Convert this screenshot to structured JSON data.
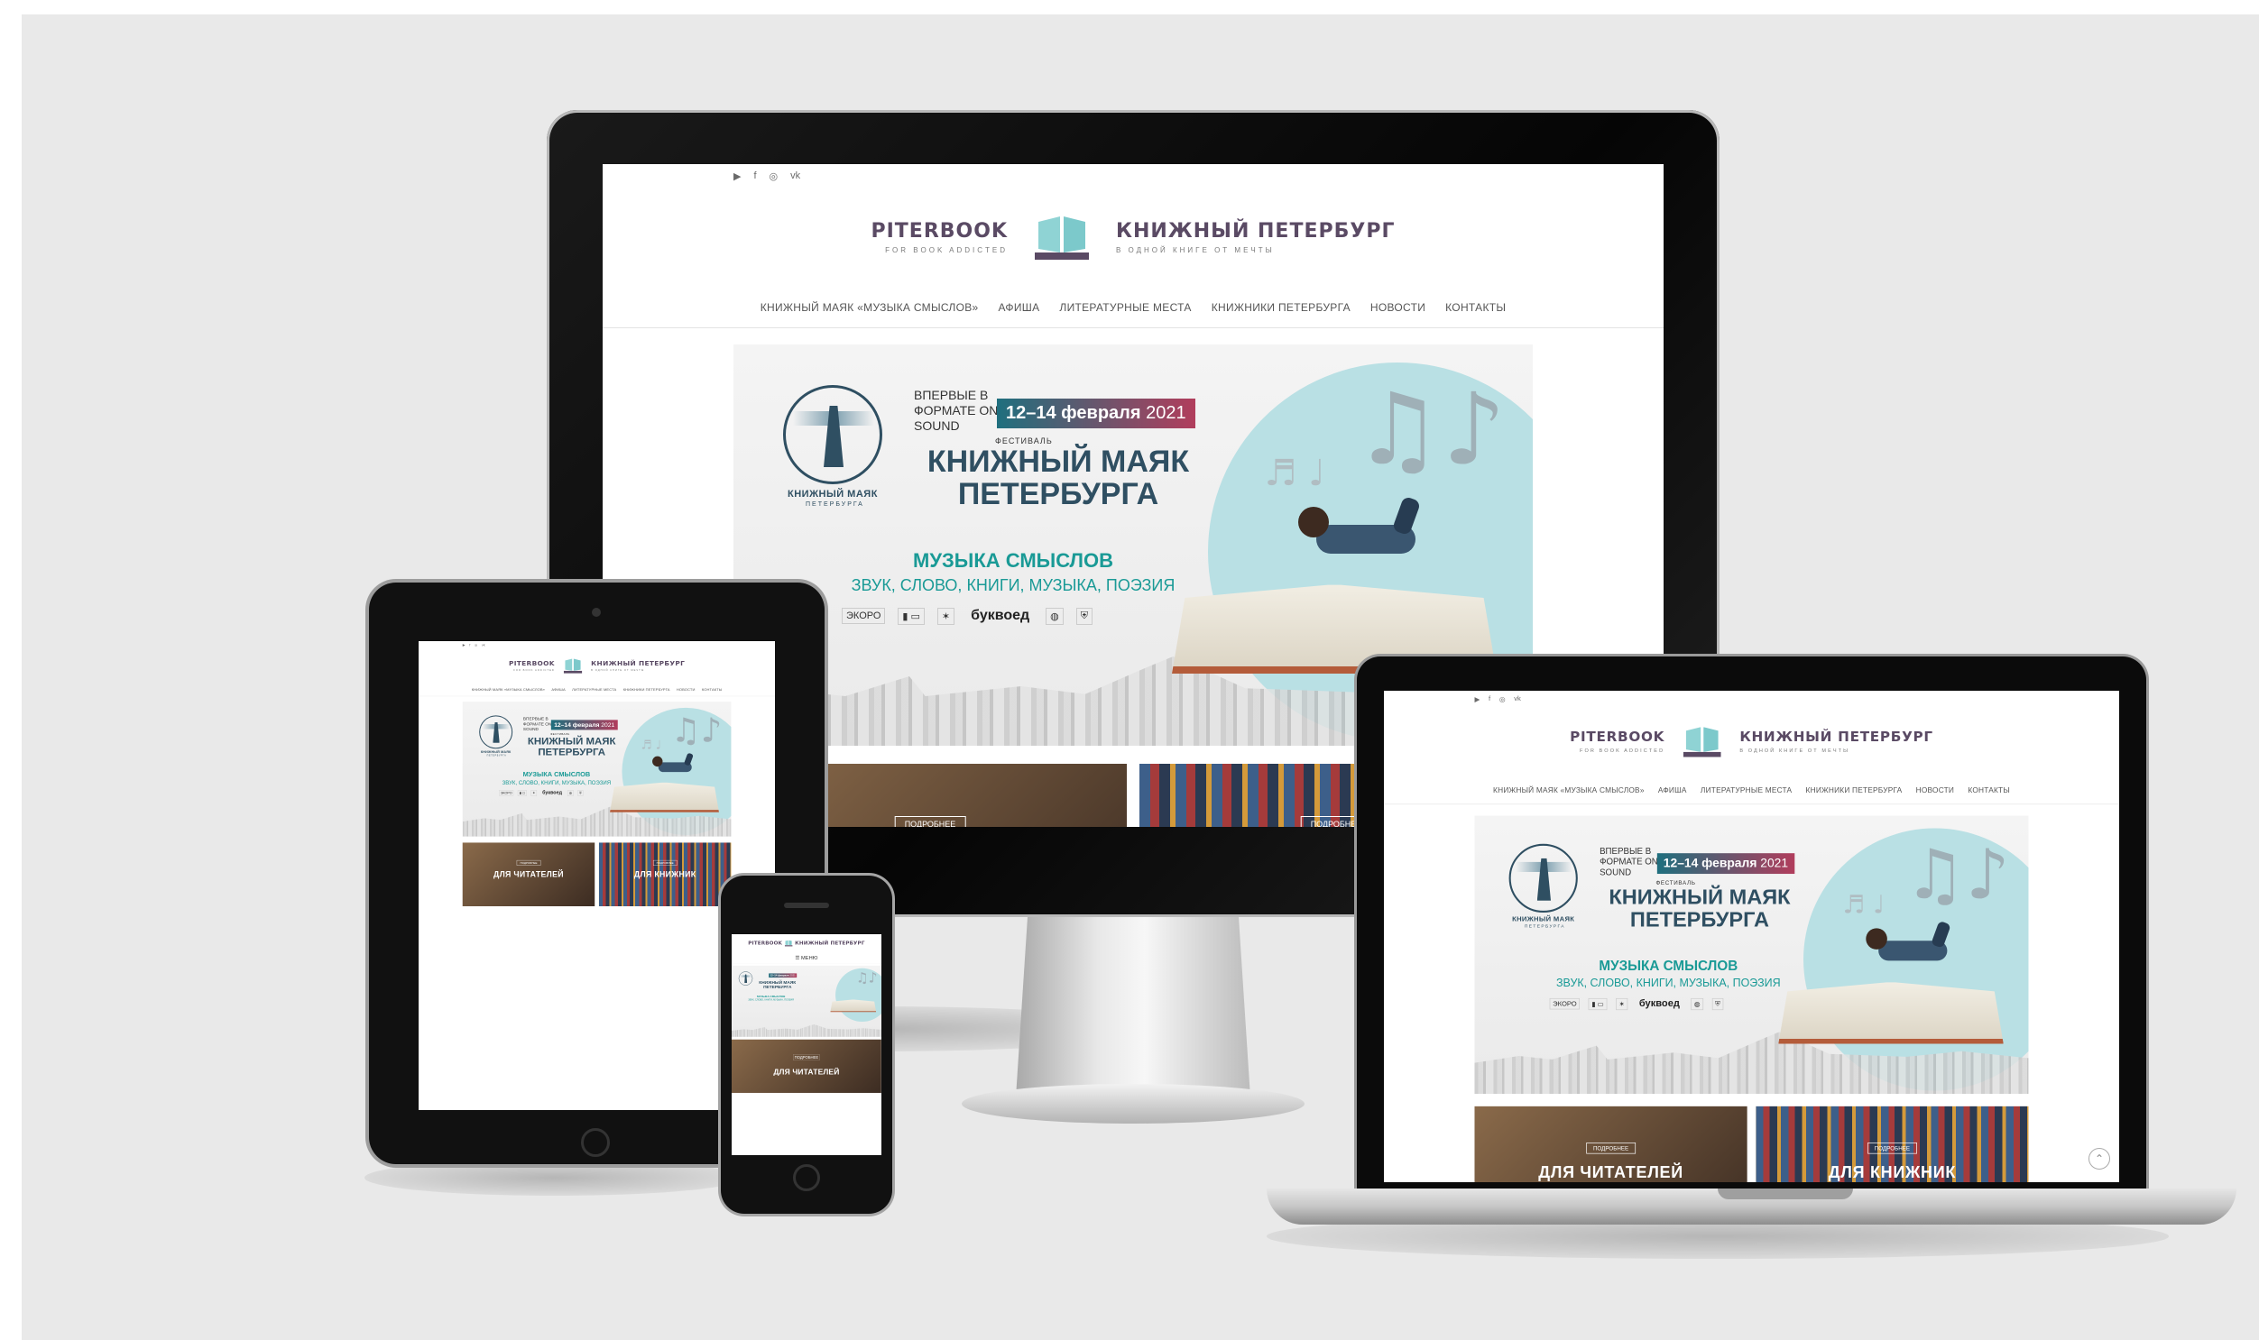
{
  "site": {
    "social_icons": [
      "youtube-icon",
      "facebook-icon",
      "instagram-icon",
      "vk-icon"
    ],
    "brand_left": {
      "main": "PITERBOOK",
      "sub": "FOR BOOK ADDICTED"
    },
    "brand_right": {
      "main": "КНИЖНЫЙ ПЕТЕРБУРГ",
      "sub": "В ОДНОЙ КНИГЕ ОТ МЕЧТЫ"
    },
    "nav": [
      "Книжный маяк «Музыка смыслов»",
      "Афиша",
      "Литературные места",
      "Книжники Петербурга",
      "Новости",
      "Контакты"
    ],
    "banner": {
      "first_time": "ВПЕРВЫЕ В ФОРМАТЕ ON-SOUND",
      "date_main": "12–14 февраля",
      "date_year": " 2021",
      "festival": "ФЕСТИВАЛЬ",
      "title": "КНИЖНЫЙ МАЯК ПЕТЕРБУРГА",
      "emblem_caption": "КНИЖНЫЙ МАЯК",
      "emblem_sub": "ПЕТЕРБУРГА",
      "music": "МУЗЫКА СМЫСЛОВ",
      "genres": "ЗВУК, СЛОВО, КНИГИ, МУЗЫКА, ПОЭЗИЯ",
      "partners": [
        "ЭКОРО",
        "буквоед"
      ]
    },
    "tiles": [
      {
        "button": "ПОДРОБНЕЕ",
        "label": "ДЛЯ ЧИТАТЕЛЕЙ"
      },
      {
        "button": "ПОДРОБНЕЕ",
        "label": "ДЛЯ КНИЖНИК"
      }
    ],
    "mobile_menu": "☰ МЕНЮ"
  },
  "colors": {
    "brand": "#5a4a64",
    "accent_teal": "#1a9a96",
    "banner_navy": "#2f4f62",
    "date_gradient_start": "#1f6f7e",
    "date_gradient_end": "#b13d5c",
    "background": "#e9e9e9"
  }
}
